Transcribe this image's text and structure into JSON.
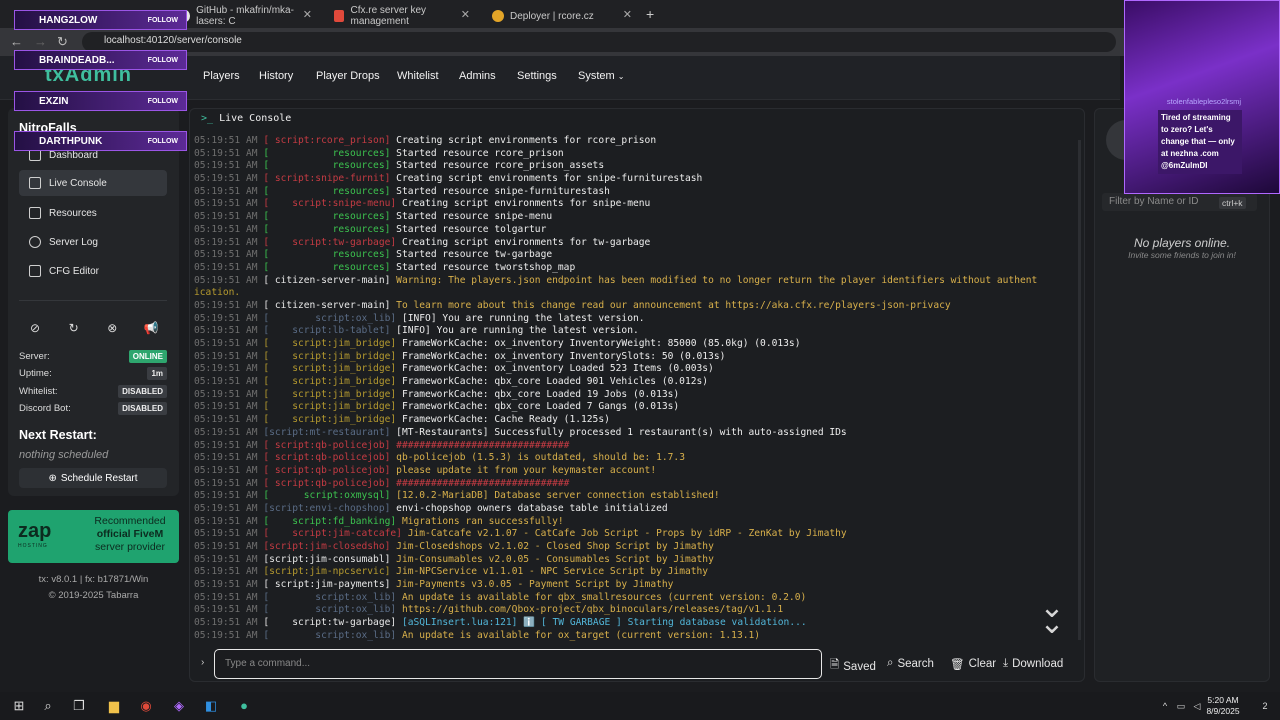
{
  "browser": {
    "tabs": [
      {
        "label": "GitHub - mkafrin/mka-lasers: C"
      },
      {
        "label": "Cfx.re server key management"
      },
      {
        "label": "Deployer | rcore.cz"
      }
    ],
    "new_tab": "+",
    "url": "localhost:40120/server/console"
  },
  "logo": "txAdmin",
  "nav": {
    "items": [
      "Players",
      "History",
      "Player Drops",
      "Whitelist",
      "Admins",
      "Settings",
      "System"
    ]
  },
  "sidebar": {
    "server_name": "NitroFalls",
    "menu": [
      "Dashboard",
      "Live Console",
      "Resources",
      "Server Log",
      "CFG Editor"
    ],
    "status": [
      {
        "label": "Server:",
        "value": "ONLINE"
      },
      {
        "label": "Uptime:",
        "value": "1m"
      },
      {
        "label": "Whitelist:",
        "value": "DISABLED"
      },
      {
        "label": "Discord Bot:",
        "value": "DISABLED"
      }
    ],
    "next_restart_title": "Next Restart:",
    "next_restart_value": "nothing scheduled",
    "schedule_btn": "Schedule Restart",
    "ad": {
      "logo": "zap",
      "sub": "HOSTING",
      "line1": "Recommended",
      "line2": "official FiveM",
      "line3": "server provider"
    },
    "version": "tx: v8.0.1 | fx: b17871/Win",
    "copyright": "© 2019-2025 Tabarra"
  },
  "console": {
    "title": "Live Console",
    "placeholder": "Type a command...",
    "buttons": [
      "Saved",
      "Search",
      "Clear",
      "Download"
    ],
    "lines": [
      {
        "ts": "05:19:51 AM",
        "src": "[ script:rcore_prison]",
        "sc": "r",
        "msg": "Creating script environments for rcore_prison",
        "mc": "w"
      },
      {
        "ts": "05:19:51 AM",
        "src": "[           resources]",
        "sc": "g",
        "msg": "Started resource rcore_prison",
        "mc": "w"
      },
      {
        "ts": "05:19:51 AM",
        "src": "[           resources]",
        "sc": "g",
        "msg": "Started resource rcore_prison_assets",
        "mc": "w"
      },
      {
        "ts": "05:19:51 AM",
        "src": "[ script:snipe-furnit]",
        "sc": "r",
        "msg": "Creating script environments for snipe-furniturestash",
        "mc": "w"
      },
      {
        "ts": "05:19:51 AM",
        "src": "[           resources]",
        "sc": "g",
        "msg": "Started resource snipe-furniturestash",
        "mc": "w"
      },
      {
        "ts": "05:19:51 AM",
        "src": "[    script:snipe-menu]",
        "sc": "r",
        "msg": "Creating script environments for snipe-menu",
        "mc": "w"
      },
      {
        "ts": "05:19:51 AM",
        "src": "[           resources]",
        "sc": "g",
        "msg": "Started resource snipe-menu",
        "mc": "w"
      },
      {
        "ts": "05:19:51 AM",
        "src": "[           resources]",
        "sc": "g",
        "msg": "Started resource tolgartur",
        "mc": "w"
      },
      {
        "ts": "05:19:51 AM",
        "src": "[    script:tw-garbage]",
        "sc": "r",
        "msg": "Creating script environments for tw-garbage",
        "mc": "w"
      },
      {
        "ts": "05:19:51 AM",
        "src": "[           resources]",
        "sc": "g",
        "msg": "Started resource tw-garbage",
        "mc": "w"
      },
      {
        "ts": "05:19:51 AM",
        "src": "[           resources]",
        "sc": "g",
        "msg": "Started resource tworstshop_map",
        "mc": "w"
      },
      {
        "ts": "05:19:51 AM",
        "src": "[ citizen-server-main]",
        "sc": "w",
        "msg": "Warning: The players.json endpoint has been modified to no longer return the player identifiers without authent",
        "mc": "y"
      },
      {
        "ts": "",
        "src": "ication.",
        "sc": "y",
        "msg": "",
        "mc": "y"
      },
      {
        "ts": "05:19:51 AM",
        "src": "[ citizen-server-main]",
        "sc": "w",
        "msg": "To learn more about this change read our announcement at https://aka.cfx.re/players-json-privacy",
        "mc": "y"
      },
      {
        "ts": "05:19:51 AM",
        "src": "[        script:ox_lib]",
        "sc": "b",
        "msg": "[INFO] You are running the latest version.",
        "mc": "w"
      },
      {
        "ts": "05:19:51 AM",
        "src": "[    script:lb-tablet]",
        "sc": "b",
        "msg": "[INFO] You are running the latest version.",
        "mc": "w"
      },
      {
        "ts": "05:19:51 AM",
        "src": "[    script:jim_bridge]",
        "sc": "y",
        "msg": "FrameWorkCache: ox_inventory InventoryWeight: 85000 (85.0kg) (0.013s)",
        "mc": "w"
      },
      {
        "ts": "05:19:51 AM",
        "src": "[    script:jim_bridge]",
        "sc": "y",
        "msg": "FrameWorkCache: ox_inventory InventorySlots: 50 (0.013s)",
        "mc": "w"
      },
      {
        "ts": "05:19:51 AM",
        "src": "[    script:jim_bridge]",
        "sc": "y",
        "msg": "FrameworkCache: ox_inventory Loaded 523 Items (0.003s)",
        "mc": "w"
      },
      {
        "ts": "05:19:51 AM",
        "src": "[    script:jim_bridge]",
        "sc": "y",
        "msg": "FrameworkCache: qbx_core Loaded 901 Vehicles (0.012s)",
        "mc": "w"
      },
      {
        "ts": "05:19:51 AM",
        "src": "[    script:jim_bridge]",
        "sc": "y",
        "msg": "FrameworkCache: qbx_core Loaded 19 Jobs (0.013s)",
        "mc": "w"
      },
      {
        "ts": "05:19:51 AM",
        "src": "[    script:jim_bridge]",
        "sc": "y",
        "msg": "FrameworkCache: qbx_core Loaded 7 Gangs (0.013s)",
        "mc": "w"
      },
      {
        "ts": "05:19:51 AM",
        "src": "[    script:jim_bridge]",
        "sc": "y",
        "msg": "FrameworkCache: Cache Ready (1.125s)",
        "mc": "w"
      },
      {
        "ts": "05:19:51 AM",
        "src": "[script:mt-restaurant]",
        "sc": "b",
        "msg": "[MT-Restaurants] Successfully processed 1 restaurant(s) with auto-assigned IDs",
        "mc": "w"
      },
      {
        "ts": "05:19:51 AM",
        "src": "[ script:qb-policejob]",
        "sc": "r",
        "msg": "##############################",
        "mc": "r"
      },
      {
        "ts": "05:19:51 AM",
        "src": "[ script:qb-policejob]",
        "sc": "r",
        "msg": "qb-policejob (1.5.3) is outdated, should be: 1.7.3",
        "mc": "y"
      },
      {
        "ts": "05:19:51 AM",
        "src": "[ script:qb-policejob]",
        "sc": "r",
        "msg": "please update it from your keymaster account!",
        "mc": "y"
      },
      {
        "ts": "05:19:51 AM",
        "src": "[ script:qb-policejob]",
        "sc": "r",
        "msg": "##############################",
        "mc": "r"
      },
      {
        "ts": "05:19:51 AM",
        "src": "[      script:oxmysql]",
        "sc": "g",
        "msg": "[12.0.2-MariaDB] Database server connection established!",
        "mc": "y"
      },
      {
        "ts": "05:19:51 AM",
        "src": "[script:envi-chopshop]",
        "sc": "b",
        "msg": "envi-chopshop owners database table initialized",
        "mc": "w"
      },
      {
        "ts": "05:19:51 AM",
        "src": "[    script:fd_banking]",
        "sc": "g",
        "msg": "Migrations ran successfully!",
        "mc": "y"
      },
      {
        "ts": "05:19:51 AM",
        "src": "[    script:jim-catcafe]",
        "sc": "r",
        "msg": "Jim-Catcafe v2.1.07 - CatCafe Job Script - Props by idRP - ZenKat by Jimathy",
        "mc": "y"
      },
      {
        "ts": "05:19:51 AM",
        "src": "[script:jim-closedsho]",
        "sc": "r",
        "msg": "Jim-Closedshops v2.1.02 - Closed Shop Script by Jimathy",
        "mc": "y"
      },
      {
        "ts": "05:19:51 AM",
        "src": "[script:jim-consumabl]",
        "sc": "w",
        "msg": "Jim-Consumables v2.0.05 - Consumables Script by Jimathy",
        "mc": "y"
      },
      {
        "ts": "05:19:51 AM",
        "src": "[script:jim-npcservic]",
        "sc": "y",
        "msg": "Jim-NPCService v1.1.01 - NPC Service Script by Jimathy",
        "mc": "y"
      },
      {
        "ts": "05:19:51 AM",
        "src": "[ script:jim-payments]",
        "sc": "w",
        "msg": "Jim-Payments v3.0.05 - Payment Script by Jimathy",
        "mc": "y"
      },
      {
        "ts": "05:19:51 AM",
        "src": "[        script:ox_lib]",
        "sc": "b",
        "msg": "An update is available for qbx_smallresources (current version: 0.2.0)",
        "mc": "y"
      },
      {
        "ts": "05:19:51 AM",
        "src": "[        script:ox_lib]",
        "sc": "b",
        "msg": "https://github.com/Qbox-project/qbx_binoculars/releases/tag/v1.1.1",
        "mc": "y"
      },
      {
        "ts": "05:19:51 AM",
        "src": "[    script:tw-garbage]",
        "sc": "w",
        "msg": "[aSQLInsert.lua:121] ℹ️ [ TW GARBAGE ] Starting database validation...",
        "mc": "c"
      },
      {
        "ts": "05:19:51 AM",
        "src": "[        script:ox_lib]",
        "sc": "b",
        "msg": "An update is available for ox_target (current version: 1.13.1)",
        "mc": "y"
      }
    ]
  },
  "players_panel": {
    "filter_placeholder": "Filter by Name or ID",
    "shortcut": "ctrl+k",
    "empty_title": "No players online.",
    "empty_sub": "Invite some friends to join in!"
  },
  "stream": {
    "badges": [
      {
        "name": "HANG2LOW",
        "action": "FOLLOW"
      },
      {
        "name": "BRAINDEADB...",
        "action": "FOLLOW"
      },
      {
        "name": "EXZIN",
        "action": "FOLLOW"
      },
      {
        "name": "DARTHPUNK",
        "action": "FOLLOW"
      }
    ],
    "user": "stolenfablepleso2lrsmj",
    "message": "Tired of streaming to zero? Let's change that — only at nezhna .com @6mZulmDI"
  },
  "taskbar": {
    "time": "5:20 AM",
    "date": "8/9/2025",
    "notif": "2"
  }
}
